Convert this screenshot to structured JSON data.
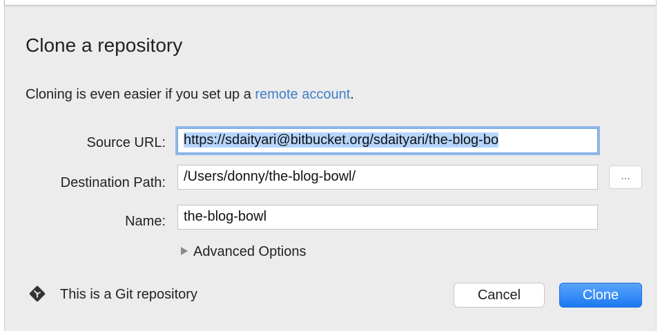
{
  "dialog": {
    "title": "Clone a repository",
    "info_prefix": "Cloning is even easier if you set up a ",
    "info_link": "remote account",
    "info_suffix": "."
  },
  "form": {
    "source_url_label": "Source URL:",
    "source_url_value": "https://sdaityari@bitbucket.org/sdaityari/the-blog-bo",
    "destination_label": "Destination Path:",
    "destination_value": "/Users/donny/the-blog-bowl/",
    "browse_label": "...",
    "name_label": "Name:",
    "name_value": "the-blog-bowl",
    "advanced_label": "Advanced Options"
  },
  "footer": {
    "repo_type_text": "This is a Git repository",
    "cancel_label": "Cancel",
    "clone_label": "Clone"
  },
  "colors": {
    "link": "#3f7ec9",
    "primary_button": "#1b79f2",
    "git_icon": "#333333",
    "dialog_background": "#ececec"
  },
  "icons": {
    "git": "git-diamond-icon",
    "disclosure": "disclosure-triangle-icon"
  }
}
